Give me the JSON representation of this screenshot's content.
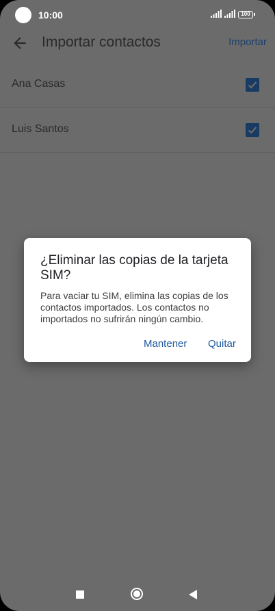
{
  "status_bar": {
    "time": "10:00",
    "battery": "100"
  },
  "app_bar": {
    "title": "Importar contactos",
    "action": "Importar"
  },
  "contacts": [
    {
      "name": "Ana Casas",
      "checked": true
    },
    {
      "name": "Luis Santos",
      "checked": true
    }
  ],
  "dialog": {
    "title": "¿Eliminar las copias de la tarjeta SIM?",
    "body": "Para vaciar tu SIM, elimina las copias de los contactos importados. Los contactos no importados no sufrirán ningún cambio.",
    "keep_label": "Mantener",
    "remove_label": "Quitar"
  },
  "colors": {
    "scrim_background": "#6b6b6b",
    "accent": "#1e5aa0",
    "checkbox": "#173b63"
  }
}
